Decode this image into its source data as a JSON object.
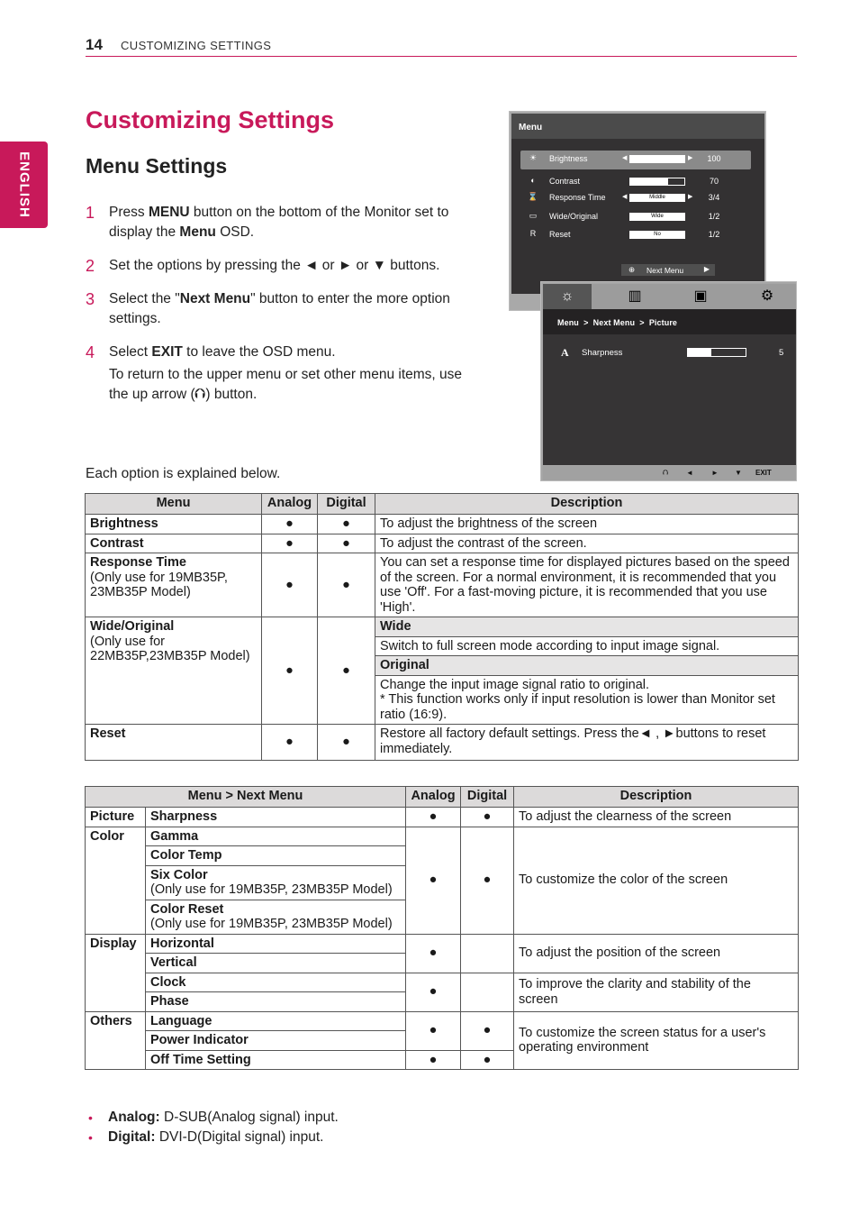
{
  "header": {
    "page_number": "14",
    "running_title": "CUSTOMIZING SETTINGS",
    "language_tab": "ENGLISH"
  },
  "colors": {
    "accent": "#c8195a",
    "table_header_bg": "#dcdada",
    "osd_bg": "#333132"
  },
  "title": "Customizing Settings",
  "subtitle": "Menu Settings",
  "steps": [
    {
      "num": "1",
      "parts": [
        "Press ",
        "MENU",
        " button on the bottom of the Monitor set to display the ",
        "Menu",
        " OSD."
      ]
    },
    {
      "num": "2",
      "parts": [
        "Set the options by pressing the ◄ or ► or ▼ buttons."
      ]
    },
    {
      "num": "3",
      "parts": [
        "Select the \"",
        "Next Menu",
        "\" button to enter the more option settings."
      ]
    },
    {
      "num": "4",
      "parts": [
        "Select ",
        "EXIT",
        " to leave the OSD menu."
      ],
      "extra": "To return to the upper menu or set other menu items, use the up arrow (⮉) button."
    }
  ],
  "explain_text": "Each option is explained below.",
  "osd_menu": {
    "title": "Menu",
    "rows": [
      {
        "icon": "brightness-icon",
        "glyph": "☀",
        "label": "Brightness",
        "bar_text": "",
        "fill": 1.0,
        "value": "100",
        "arrows": true,
        "selected": true
      },
      {
        "icon": "contrast-icon",
        "glyph": "◐",
        "label": "Contrast",
        "bar_text": "",
        "fill": 0.7,
        "value": "70",
        "arrows": false,
        "selected": false
      },
      {
        "icon": "response-time-icon",
        "glyph": "⌛",
        "label": "Response Time",
        "bar_text": "Middle",
        "fill": 0,
        "value": "3/4",
        "arrows": true,
        "selected": false
      },
      {
        "icon": "wide-original-icon",
        "glyph": "▭",
        "label": "Wide/Original",
        "bar_text": "Wide",
        "fill": 0,
        "value": "1/2",
        "arrows": false,
        "selected": false
      },
      {
        "icon": "reset-icon",
        "glyph": "R",
        "label": "Reset",
        "bar_text": "No",
        "fill": 0,
        "value": "1/2",
        "arrows": false,
        "selected": false
      }
    ],
    "next_menu_label": "Next Menu"
  },
  "osd_next_menu": {
    "tabs": [
      {
        "name": "picture-tab-icon",
        "glyph": "☼",
        "active": true
      },
      {
        "name": "color-tab-icon",
        "glyph": "▥",
        "active": false
      },
      {
        "name": "display-tab-icon",
        "glyph": "▣",
        "active": false
      },
      {
        "name": "others-tab-icon",
        "glyph": "⚙",
        "active": false
      }
    ],
    "breadcrumb": "Menu  >  Next Menu  >  Picture",
    "row": {
      "glyph": "A",
      "label": "Sharpness",
      "fill": 0.4,
      "value": "5"
    },
    "footer": {
      "up": "⮉",
      "left": "◄",
      "right": "►",
      "down": "▼",
      "exit": "EXIT"
    }
  },
  "table1": {
    "headers": [
      "Menu",
      "Analog",
      "Digital",
      "Description"
    ],
    "bullet": "●",
    "rows": {
      "brightness": {
        "name": "Brightness",
        "desc": "To adjust the brightness of the screen"
      },
      "contrast": {
        "name": "Contrast",
        "desc": "To adjust the contrast of the screen."
      },
      "response": {
        "name": "Response Time",
        "note": "(Only use for 19MB35P, 23MB35P Model)",
        "desc": "You can set a response time for displayed pictures based on the speed of the screen. For a normal environment, it is recommended that you use 'Off'. For a fast-moving picture, it is recommended that you use 'High'."
      },
      "wide": {
        "name": "Wide/Original",
        "note": "(Only use for 22MB35P,23MB35P Model)",
        "sub1": "Wide",
        "desc1": "Switch to full screen mode according to input image signal.",
        "sub2": "Original",
        "desc2a": "Change the input image signal ratio to original.",
        "desc2b": "* This function works only if input resolution is lower than Monitor set ratio (16:9)."
      },
      "reset": {
        "name": "Reset",
        "desc": "Restore all factory default settings. Press the◄ , ►buttons to reset immediately."
      }
    }
  },
  "table2": {
    "headers": [
      "Menu > Next Menu",
      "Analog",
      "Digital",
      "Description"
    ],
    "bullet": "●",
    "groups": {
      "picture": {
        "name": "Picture",
        "items": [
          "Sharpness"
        ],
        "desc": "To adjust the clearness of the screen"
      },
      "color": {
        "name": "Color",
        "items": [
          "Gamma",
          "Color Temp",
          "Six Color",
          "Color Reset"
        ],
        "note": "(Only use for 19MB35P, 23MB35P Model)",
        "desc": "To customize the color of the screen"
      },
      "display": {
        "name": "Display",
        "items": [
          "Horizontal",
          "Vertical",
          "Clock",
          "Phase"
        ],
        "desc1": "To adjust the position of the screen",
        "desc2": "To improve the clarity and stability of the screen"
      },
      "others": {
        "name": "Others",
        "items": [
          "Language",
          "Power Indicator",
          "Off Time Setting"
        ],
        "desc": "To customize the screen status for a user's operating environment"
      }
    }
  },
  "notes": [
    {
      "term": "Analog:",
      "text": " D-SUB(Analog signal) input."
    },
    {
      "term": "Digital:",
      "text": " DVI-D(Digital signal) input."
    }
  ]
}
